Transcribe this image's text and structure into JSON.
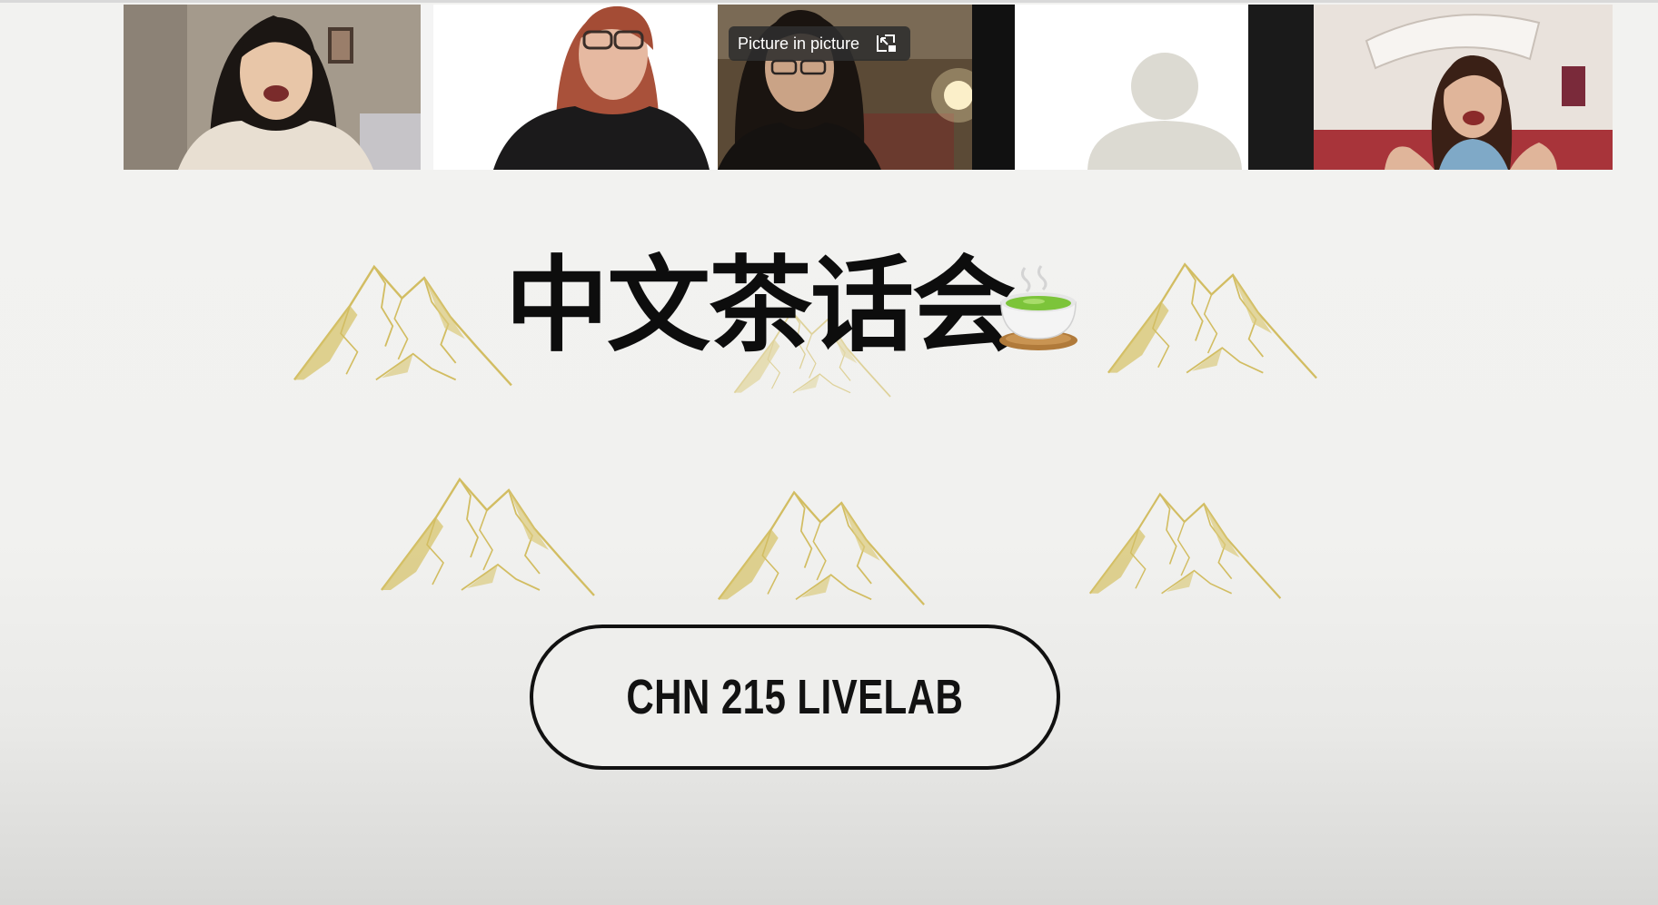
{
  "video_strip": {
    "pip_overlay": {
      "label": "Picture in picture",
      "icon": "picture-in-picture-icon"
    },
    "participants": [
      {
        "tile": "participant-video-1",
        "type": "camera"
      },
      {
        "tile": "participant-video-2",
        "type": "camera"
      },
      {
        "tile": "participant-video-3",
        "type": "camera"
      },
      {
        "tile": "participant-video-4",
        "type": "avatar-placeholder",
        "icon": "person-icon"
      },
      {
        "tile": "participant-video-5",
        "type": "camera"
      }
    ]
  },
  "slide": {
    "title": "中文茶话会",
    "title_emoji_icon": "green-tea-cup-icon",
    "decoration_icon": "mountain-illustration-icon",
    "accent_gold": "#cdb54a",
    "pill_label": "CHN 215 LIVELAB"
  }
}
